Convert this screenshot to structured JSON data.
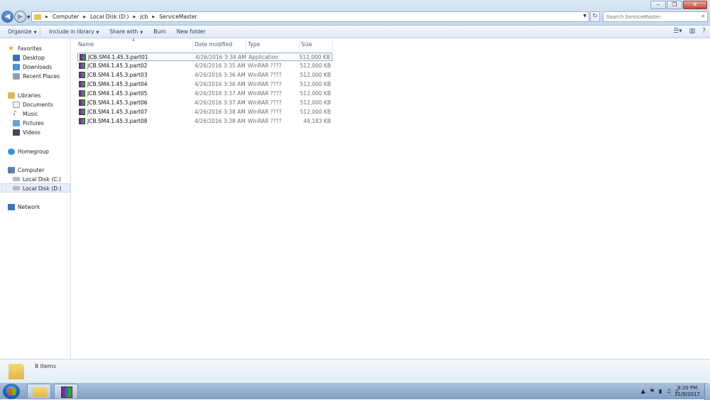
{
  "window": {
    "controls": {
      "minimize": "–",
      "maximize": "❐",
      "close": "✕"
    }
  },
  "address": {
    "breadcrumbs": [
      "Computer",
      "Local Disk (D:)",
      "jcb",
      "ServiceMaster"
    ]
  },
  "search": {
    "placeholder": "Search ServiceMaster"
  },
  "toolbar": {
    "organize": "Organize",
    "include_in_library": "Include in library",
    "share_with": "Share with",
    "burn": "Burn",
    "new_folder": "New folder"
  },
  "navigation": {
    "favorites": {
      "label": "Favorites",
      "items": [
        "Desktop",
        "Downloads",
        "Recent Places"
      ]
    },
    "libraries": {
      "label": "Libraries",
      "items": [
        "Documents",
        "Music",
        "Pictures",
        "Videos"
      ]
    },
    "homegroup": "Homegroup",
    "computer": {
      "label": "Computer",
      "items": [
        "Local Disk (C:)",
        "Local Disk (D:)"
      ]
    },
    "network": "Network"
  },
  "columns": {
    "name": "Name",
    "date": "Date modified",
    "type": "Type",
    "size": "Size"
  },
  "files": [
    {
      "name": "JCB.SM4.1.45.3.part01",
      "date": "4/26/2016 3:34 AM",
      "type": "Application",
      "size": "512,000 KB"
    },
    {
      "name": "JCB.SM4.1.45.3.part02",
      "date": "4/26/2016 3:35 AM",
      "type": "WinRAR ????",
      "size": "512,000 KB"
    },
    {
      "name": "JCB.SM4.1.45.3.part03",
      "date": "4/26/2016 3:36 AM",
      "type": "WinRAR ????",
      "size": "512,000 KB"
    },
    {
      "name": "JCB.SM4.1.45.3.part04",
      "date": "4/26/2016 3:36 AM",
      "type": "WinRAR ????",
      "size": "512,000 KB"
    },
    {
      "name": "JCB.SM4.1.45.3.part05",
      "date": "4/26/2016 3:37 AM",
      "type": "WinRAR ????",
      "size": "512,000 KB"
    },
    {
      "name": "JCB.SM4.1.45.3.part06",
      "date": "4/26/2016 3:37 AM",
      "type": "WinRAR ????",
      "size": "512,000 KB"
    },
    {
      "name": "JCB.SM4.1.45.3.part07",
      "date": "4/26/2016 3:38 AM",
      "type": "WinRAR ????",
      "size": "512,000 KB"
    },
    {
      "name": "JCB.SM4.1.45.3.part08",
      "date": "4/26/2016 3:38 AM",
      "type": "WinRAR ????",
      "size": "48,183 KB"
    }
  ],
  "status": {
    "item_count": "8 items"
  },
  "taskbar": {
    "time": "9:20 PM",
    "date": "11/9/2017"
  },
  "colors": {
    "accent": "#2a5fa8",
    "selection": "#e5eef9",
    "folder": "#dfb646"
  }
}
